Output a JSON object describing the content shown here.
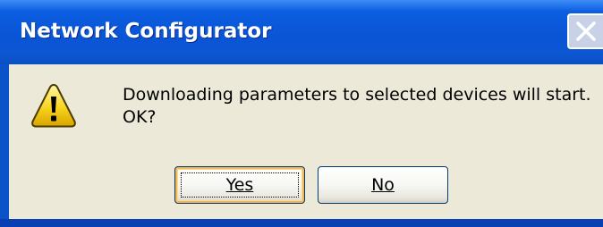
{
  "window": {
    "title": "Network Configurator",
    "close_icon": "close-icon",
    "colors": {
      "titlebar": "#0a55d6",
      "client": "#ece9d8",
      "button_border": "#003c74",
      "default_highlight": "#f6b652"
    }
  },
  "dialog": {
    "icon": "warning-icon",
    "message_line1": "Downloading parameters to selected devices will start.",
    "message_line2": "OK?"
  },
  "buttons": {
    "yes_label": "Yes",
    "no_label": "No"
  }
}
